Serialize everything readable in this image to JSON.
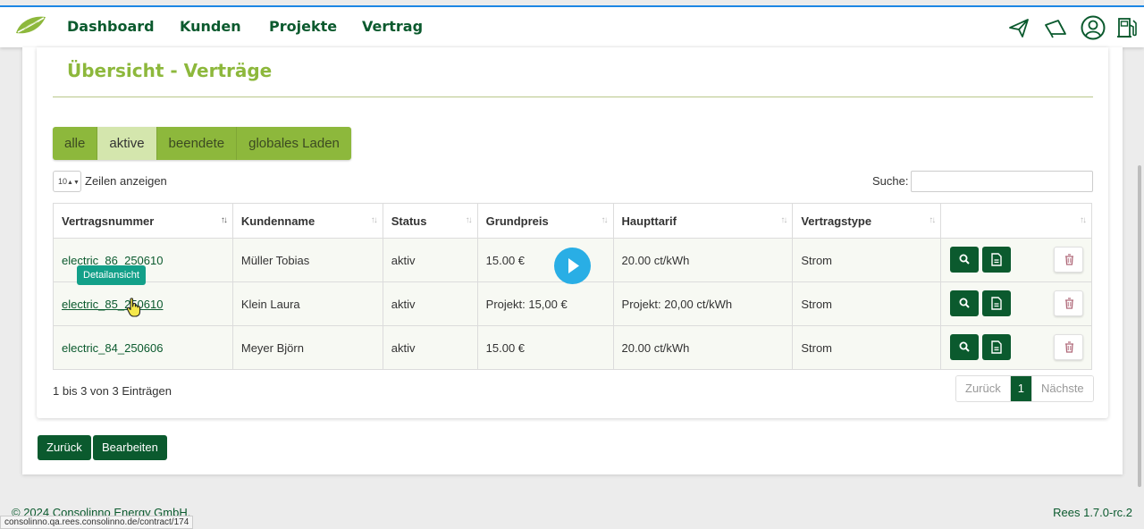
{
  "nav": {
    "items": [
      "Dashboard",
      "Kunden",
      "Projekte",
      "Vertrag"
    ],
    "icons": [
      "paper-plane-icon",
      "megaphone-icon",
      "user-circle-icon",
      "fuel-pump-icon"
    ]
  },
  "page": {
    "title": "Übersicht - Verträge"
  },
  "filters": [
    "alle",
    "aktive",
    "beendete",
    "globales Laden"
  ],
  "filter_active": "aktive",
  "length": {
    "value": "10",
    "label": "Zeilen anzeigen"
  },
  "search": {
    "label": "Suche:",
    "value": ""
  },
  "table": {
    "columns": [
      "Vertragsnummer",
      "Kundenname",
      "Status",
      "Grundpreis",
      "Haupttarif",
      "Vertragstype",
      ""
    ],
    "rows": [
      [
        "electric_86_250610",
        "Müller Tobias",
        "aktiv",
        "15.00 €",
        "20.00 ct/kWh",
        "Strom"
      ],
      [
        "electric_85_250610",
        "Klein Laura",
        "aktiv",
        "Projekt: 15,00 €",
        "Projekt: 20,00 ct/kWh",
        "Strom"
      ],
      [
        "electric_84_250606",
        "Meyer Björn",
        "aktiv",
        "15.00 €",
        "20.00 ct/kWh",
        "Strom"
      ]
    ]
  },
  "tooltip": "Detailansicht",
  "info": "1 bis 3 von 3 Einträgen",
  "pager": {
    "prev": "Zurück",
    "current": "1",
    "next": "Nächste"
  },
  "buttons": {
    "back": "Zurück",
    "edit": "Bearbeiten"
  },
  "footer": {
    "copyright": "© 2024 Consolinno Energy GmbH.",
    "version": "Rees 1.7.0-rc.2"
  },
  "status_url": "consolinno.qa.rees.consolinno.de/contract/174",
  "colors": {
    "brand_dark": "#0b5a2e",
    "brand_green": "#8db83c",
    "tooltip": "#13a089",
    "play": "#29aee5"
  }
}
